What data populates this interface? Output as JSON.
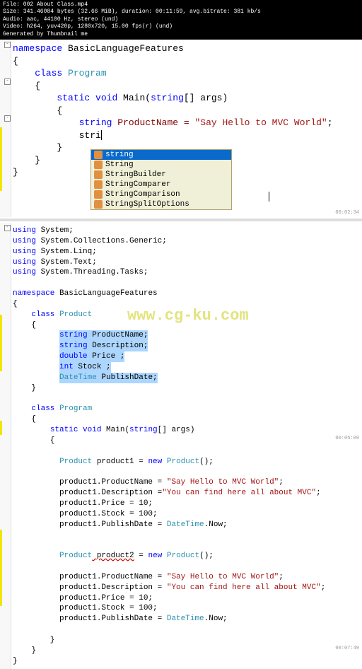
{
  "header": {
    "file": "File: 002 About Class.mp4",
    "size": "Size: 341.46084 bytes (32.66 MiB), duration: 00:11:59, avg.bitrate: 381 kb/s",
    "audio": "Audio: aac, 44100 Hz, stereo (und)",
    "video": "Video: h264, yuv420p, 1280x720, 15.00 fps(r) (und)",
    "gen": "Generated by Thumbnail me"
  },
  "watermark": "www.cg-ku.com",
  "top_block": {
    "ns_kw": "namespace",
    "ns_name": " BasicLanguageFeatures",
    "class_kw": "class",
    "class_name": " Program",
    "static_kw": "static",
    "void_kw": " void",
    "main_name": " Main(",
    "string_arr": "string",
    "args": "[] args)",
    "string_kw": "string",
    "prod_decl": " ProductName = ",
    "prod_str": "\"Say Hello to MVC World\"",
    "semi": ";",
    "typing": "stri"
  },
  "intellisense": {
    "items": [
      {
        "label": "string",
        "selected": true
      },
      {
        "label": "String",
        "selected": false
      },
      {
        "label": "StringBuilder",
        "selected": false
      },
      {
        "label": "StringComparer",
        "selected": false
      },
      {
        "label": "StringComparison",
        "selected": false
      },
      {
        "label": "StringSplitOptions",
        "selected": false
      }
    ]
  },
  "timestamps": {
    "t1": "00:02:34",
    "t2": "00:05:09",
    "t3": "00:07:49"
  },
  "usings": {
    "kw": "using",
    "u1": " System;",
    "u2": " System.Collections.Generic;",
    "u3": " System.Linq;",
    "u4": " System.Text;",
    "u5": " System.Threading.Tasks;"
  },
  "mid_block": {
    "ns_kw": "namespace",
    "ns_name": " BasicLanguageFeatures",
    "class_kw": "class",
    "product": " Product",
    "string_kw": "string",
    "pname": " ProductName;",
    "desc": " Description;",
    "double_kw": "double",
    "price": " Price ;",
    "int_kw": "int",
    "stock": " Stock ;",
    "datetime": "DateTime",
    "pubdate": " PublishDate;",
    "program": " Program",
    "static_kw": "static",
    "void_kw": " void",
    "main_name": " Main(",
    "string_arr": "string",
    "args": "[] args)",
    "prod_type": "Product",
    "p1_decl": " product1 = ",
    "new_kw": "new",
    "prod_ctor": " Product",
    "paren": "();",
    "p1_name": "product1.ProductName = ",
    "p1_name_str": "\"Say Hello to MVC World\"",
    "p1_desc": "product1.Description =",
    "p1_desc_str": "\"You can find here all about MVC\"",
    "p1_price": "product1.Price = 10;",
    "p1_stock": "product1.Stock = 100;",
    "p1_pubdate": "product1.PublishDate = ",
    "dt": "DateTime",
    "now": ".Now;",
    "p2_decl": " product2",
    "eq": " = ",
    "p1b_name": "product1.ProductName = ",
    "p1b_name_str": "\"Say Hello to MVC World\"",
    "p1b_desc": "product1.Description = ",
    "p1b_desc_str": "\"You can find here all about MVC\"",
    "p1b_price": "product1.Price = 10;",
    "p1b_stock": "product1.Stock = 100;",
    "p1b_pubdate": "product1.PublishDate = "
  }
}
